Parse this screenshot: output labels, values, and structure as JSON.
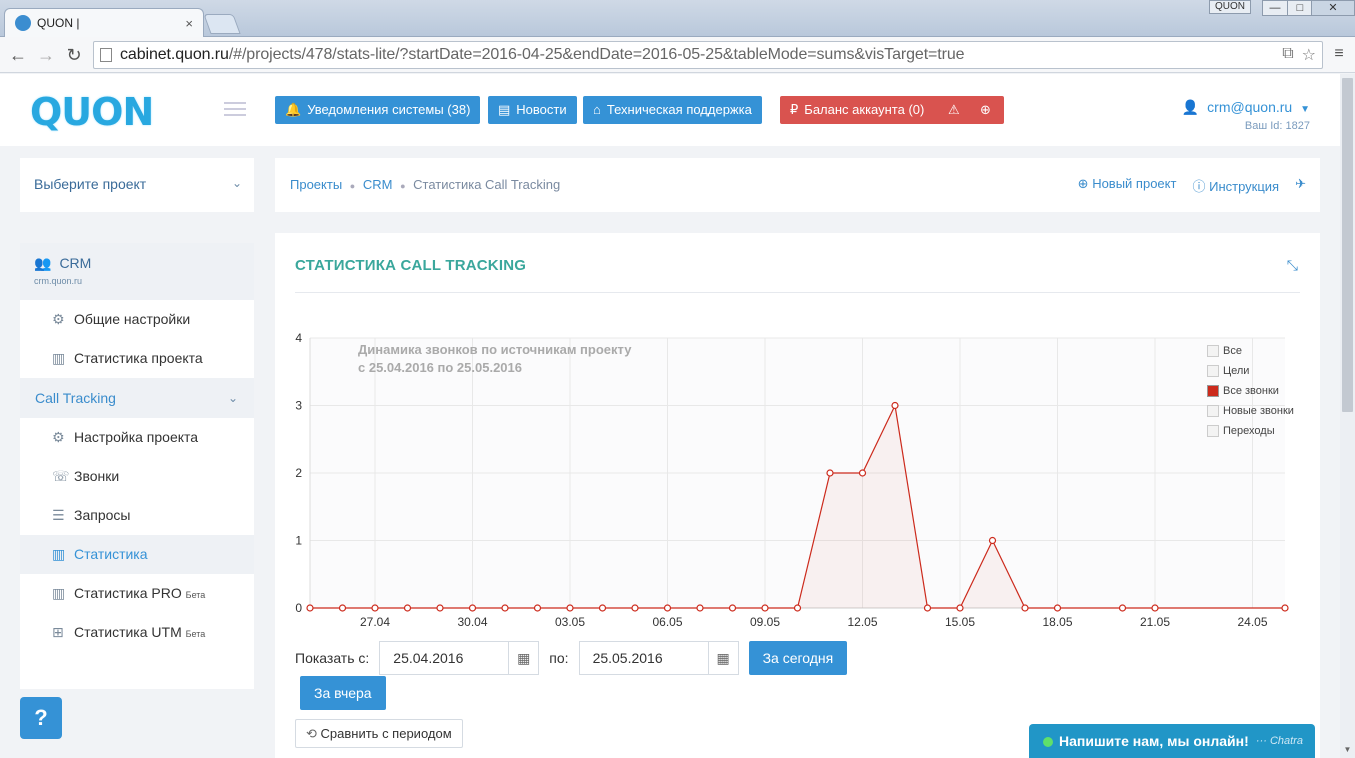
{
  "browser": {
    "tab_title": "QUON |",
    "tab_close": "×",
    "url_host": "cabinet.quon.ru",
    "url_path": "/#/projects/478/stats-lite/?startDate=2016-04-25&endDate=2016-05-25&tableMode=sums&visTarget=true",
    "window_badge": "QUON",
    "win_min": "—",
    "win_max": "□",
    "win_close": "✕"
  },
  "header": {
    "logo": "QUON",
    "buttons": [
      {
        "icon": "🔔",
        "label": "Уведомления системы (38)"
      },
      {
        "icon": "▤",
        "label": "Новости"
      },
      {
        "icon": "⌂",
        "label": "Техническая поддержка"
      },
      {
        "icon": "₽",
        "label": "Баланс аккаунта (0)",
        "warn": "⚠",
        "add": "⊕"
      }
    ],
    "user_email": "crm@quon.ru",
    "user_id": "Ваш Id: 1827"
  },
  "sidebar": {
    "project_select": "Выберите проект",
    "project_name": "CRM",
    "project_domain": "crm.quon.ru",
    "items_general": [
      {
        "icon": "⚙",
        "label": "Общие настройки"
      },
      {
        "icon": "▥",
        "label": "Статистика проекта"
      }
    ],
    "group_label": "Call Tracking",
    "items_ct": [
      {
        "icon": "⚙",
        "label": "Настройка проекта",
        "beta": ""
      },
      {
        "icon": "☏",
        "label": "Звонки",
        "beta": ""
      },
      {
        "icon": "☰",
        "label": "Запросы",
        "beta": ""
      },
      {
        "icon": "▥",
        "label": "Статистика",
        "beta": ""
      },
      {
        "icon": "▥",
        "label": "Статистика PRO",
        "beta": "Бета"
      },
      {
        "icon": "⊞",
        "label": "Статистика UTM",
        "beta": "Бета"
      }
    ],
    "help": "?"
  },
  "breadcrumbs": {
    "items": [
      "Проекты",
      "CRM",
      "Статистика Call Tracking"
    ],
    "new_project": "Новый проект",
    "instruction": "Инструкция"
  },
  "panel": {
    "title": "СТАТИСТИКА CALL TRACKING"
  },
  "chart_data": {
    "type": "area",
    "title": "Динамика звонков по источникам проекту",
    "subtitle": "с 25.04.2016 по 25.05.2016",
    "x": [
      "25.04",
      "26.04",
      "27.04",
      "28.04",
      "29.04",
      "30.04",
      "01.05",
      "02.05",
      "03.05",
      "04.05",
      "05.05",
      "06.05",
      "07.05",
      "08.05",
      "09.05",
      "10.05",
      "11.05",
      "12.05",
      "13.05",
      "14.05",
      "15.05",
      "16.05",
      "17.05",
      "18.05",
      "20.05",
      "21.05",
      "25.05"
    ],
    "tick_labels": [
      "27.04",
      "30.04",
      "03.05",
      "06.05",
      "09.05",
      "12.05",
      "15.05",
      "18.05",
      "21.05",
      "24.05"
    ],
    "y_ticks": [
      "0",
      "1",
      "2",
      "3",
      "4"
    ],
    "ylim": [
      0,
      4
    ],
    "series": [
      {
        "name": "Все звонки",
        "values": [
          0,
          0,
          0,
          0,
          0,
          0,
          0,
          0,
          0,
          0,
          0,
          0,
          0,
          0,
          0,
          0,
          2,
          2,
          3,
          0,
          0,
          1,
          0,
          0,
          0,
          0,
          0
        ],
        "color": "#cc2a1c"
      }
    ],
    "legend": [
      {
        "label": "Все",
        "checked": false
      },
      {
        "label": "Цели",
        "checked": false
      },
      {
        "label": "Все звонки",
        "checked": true
      },
      {
        "label": "Новые звонки",
        "checked": false
      },
      {
        "label": "Переходы",
        "checked": false
      }
    ],
    "grid": true
  },
  "controls": {
    "show_from_label": "Показать с:",
    "date_from": "25.04.2016",
    "to_label": "по:",
    "date_to": "25.05.2016",
    "today": "За сегодня",
    "yesterday": "За вчера",
    "compare": "Сравнить с периодом"
  },
  "chat": {
    "label": "Напишите нам, мы онлайн!",
    "brand": "Chatra"
  }
}
